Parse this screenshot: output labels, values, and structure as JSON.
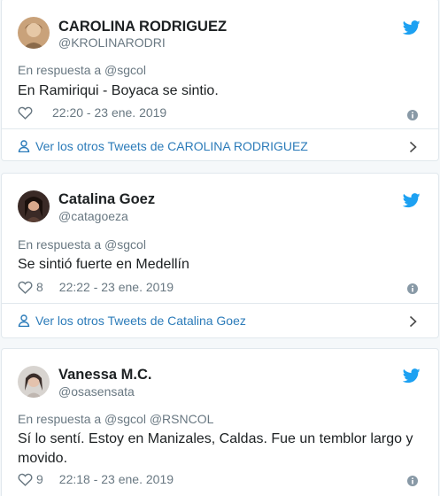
{
  "tweets": [
    {
      "name": "CAROLINA RODRIGUEZ",
      "handle": "@KROLINARODRI",
      "reply_to": "En respuesta a @sgcol",
      "text": "En Ramiriqui - Boyaca se sintio.",
      "likes": "",
      "timestamp": "22:20 - 23 ene. 2019",
      "more_link": "Ver los otros Tweets de CAROLINA RODRIGUEZ"
    },
    {
      "name": "Catalina Goez",
      "handle": "@catagoeza",
      "reply_to": "En respuesta a @sgcol",
      "text": "Se sintió fuerte en Medellín",
      "likes": "8",
      "timestamp": "22:22 - 23 ene. 2019",
      "more_link": "Ver los otros Tweets de Catalina Goez"
    },
    {
      "name": "Vanessa M.C.",
      "handle": "@osasensata",
      "reply_to": "En respuesta a @sgcol @RSNCOL",
      "text": "Sí lo sentí. Estoy en Manizales, Caldas. Fue un temblor largo y movido.",
      "likes": "9",
      "timestamp": "22:18 - 23 ene. 2019",
      "more_link": ""
    }
  ],
  "colors": {
    "link": "#2b7bb9",
    "muted": "#697882",
    "twitter_blue": "#1da1f2",
    "border": "#e1e8ed"
  },
  "icons": {
    "bird": "twitter-bird-icon",
    "heart": "heart-icon",
    "info": "info-icon",
    "person": "person-icon",
    "chevron": "chevron-right-icon"
  }
}
